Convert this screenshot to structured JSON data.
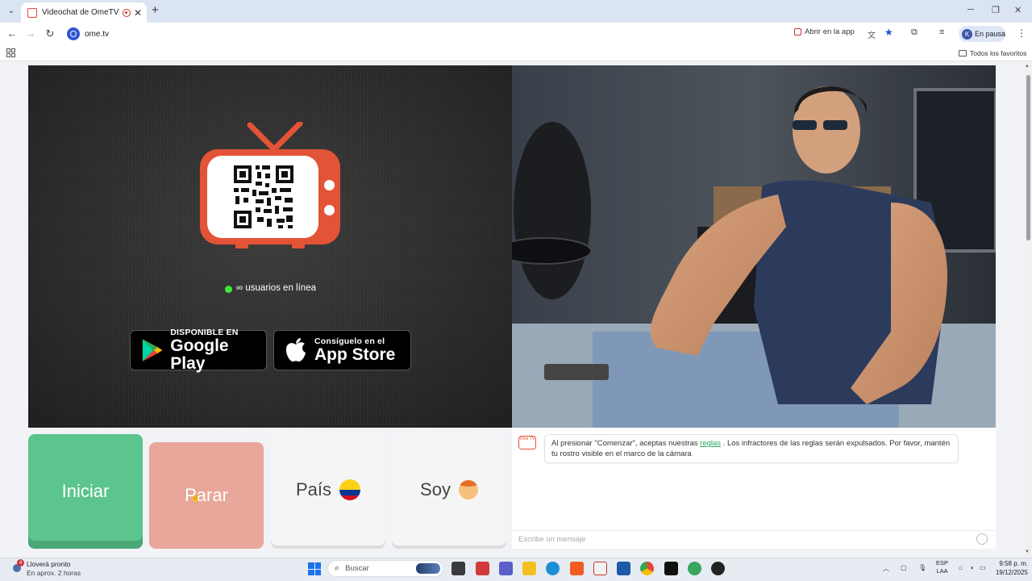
{
  "browser": {
    "tab_title": "Videochat de OmeTV: alte",
    "close_tab": "✕",
    "new_tab": "+",
    "url": "ome.tv",
    "open_in_app": "Abrir en la app",
    "profile_initial": "K",
    "profile_status": "En pausa",
    "all_bookmarks": "Todos los favoritos"
  },
  "stranger_panel": {
    "online_text": "∞ usuarios en línea",
    "google_play": {
      "line1": "DISPONIBLE EN",
      "line2": "Google Play"
    },
    "app_store": {
      "line1": "Consíguelo en el",
      "line2": "App Store"
    }
  },
  "controls": {
    "start": "Iniciar",
    "stop": "Parar",
    "country": "País",
    "gender": "Soy"
  },
  "chat": {
    "logo": "Ome TV",
    "message_before": "Al presionar \"Comenzar\", aceptas nuestras ",
    "rules_link": "reglas",
    "message_after": " . Los infractores de las reglas serán expulsados. Por favor, mantén tu rostro visible en el marco de la cámara",
    "input_placeholder": "Escribe un mensaje"
  },
  "taskbar": {
    "weather_title": "Lloverá pronto",
    "weather_sub": "En aprox. 2 horas",
    "weather_badge": "4",
    "search_placeholder": "Buscar",
    "lang_line1": "ESP",
    "lang_line2": "LAA",
    "time": "9:58 p. m.",
    "date": "19/12/2025"
  },
  "colors": {
    "brand_red": "#e35336",
    "start_green": "#5cc48d",
    "stop_salmon": "#e8a79a",
    "online_green": "#3ee83a",
    "rules_link": "#2aa45a"
  }
}
